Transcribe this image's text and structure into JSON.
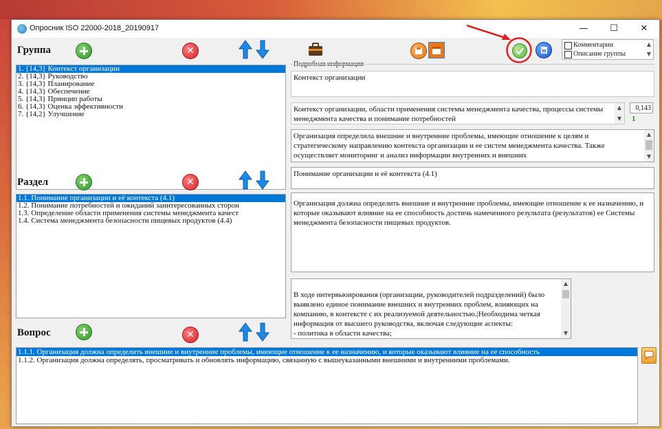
{
  "window": {
    "title": "Опросник ISO 22000-2018_20190917",
    "minimize": "—",
    "maximize": "☐",
    "close": "✕"
  },
  "groups": {
    "label": "Группа",
    "items": [
      "1. {14,3} Контекст организации",
      "2. {14,3} Руководство",
      "3. {14,3} Планирование",
      "4. {14,3} Обеспечение",
      "5. {14,3} Принцип работы",
      "6. {14,3} Оценка эффективности",
      "7. {14,2} Улучшение"
    ],
    "selected_index": 0
  },
  "sections": {
    "label": "Раздел",
    "items": [
      "1.1. Понимание организации и её контекста (4.1)",
      "1.2. Понимание потребностей и ожиданий заинтересованных сторон",
      "1.3. Определение области применения системы менеджмента качест",
      "1.4. Система менеджмента безопасности пищевых продуктов (4.4)"
    ],
    "selected_index": 0
  },
  "questions": {
    "label": "Вопрос",
    "items": [
      "1.1.1. Организация должна определить внешние и внутренние проблемы, имеющие отношение к ее назначению, и которые оказывают влияние на ее способность",
      "1.1.2. Организация должна определять, просматривать и обновлять информацию, связанную с вышеуказанными внешними и внутренними проблемами."
    ],
    "selected_index": 0
  },
  "options": {
    "comments": "Комментарии",
    "group_description": "Описание группы"
  },
  "details": {
    "label": "Подробная информация",
    "group_title": "Контекст организации",
    "group_subtitle": "Контекст организации, области применения системы менеджмента качества, процессы системы менеджмента качества и понимание потребностей",
    "score": "0,143",
    "count": "1",
    "group_description": "Организация определила внешние и внутренние проблемы, имеющие отношение к целям и стратегическому направлению контекста организации и ее систем менеджмента качества. Также осуществляет мониторинг и анализ информации внутренних и внешних",
    "section_title": "Понимание организации и её контекста (4.1)",
    "section_text": "Организация должна определить внешние и внутренние проблемы, имеющие отношение к ее назначению, и которые оказывают влияние на ее способность достичь намеченного результата (результатов) ее Системы менеджмента безопасности пищевых продуктов.",
    "interview_text": "В ходе интервьюирования (организации, руководителей подразделений) было выявлено единое понимание внешних и внутренних проблем, влияющих на компанию, в контексте с их реализуемой деятельностью.|Необходима четкая информация от высшего руководства, включая следующие аспекты:\n- политика в области качества;"
  },
  "colors": {
    "selection": "#0078d7",
    "add": "#2f9a2a",
    "delete": "#d8232a",
    "arrows": "#1e88e5",
    "annotation": "#e02020"
  }
}
